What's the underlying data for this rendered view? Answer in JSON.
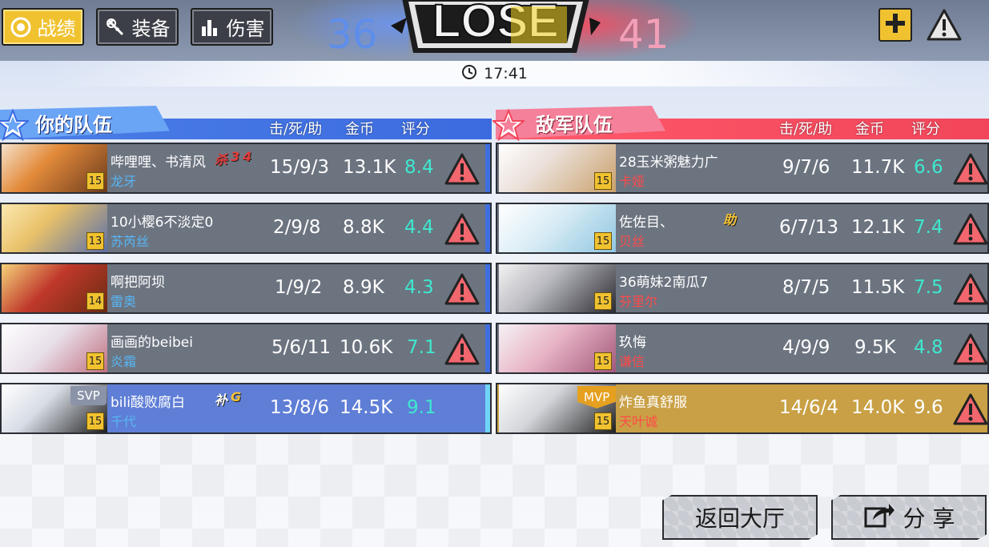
{
  "tabs": [
    {
      "label": "战绩",
      "icon": "target-icon",
      "active": true
    },
    {
      "label": "装备",
      "icon": "equipment-icon",
      "active": false
    },
    {
      "label": "伤害",
      "icon": "bar-chart-icon",
      "active": false
    }
  ],
  "result": {
    "banner": "LOSE",
    "score_ally": "36",
    "score_enemy": "41"
  },
  "timer": {
    "time": "17:41"
  },
  "ally_team": {
    "title": "你的队伍",
    "col_kda": "击/死/助",
    "col_gold": "金币",
    "col_rate": "评分",
    "players": [
      {
        "name": "哔哩哩、书清风",
        "hero": "龙牙",
        "level": "15",
        "kda": "15/9/3",
        "gold": "13.1K",
        "rating": "8.4",
        "tags": [
          "杀",
          "3",
          "4"
        ]
      },
      {
        "name": "10小樱6不淡定0",
        "hero": "苏芮丝",
        "level": "13",
        "kda": "2/9/8",
        "gold": "8.8K",
        "rating": "4.4"
      },
      {
        "name": "啊把阿坝",
        "hero": "雷奥",
        "level": "14",
        "kda": "1/9/2",
        "gold": "8.9K",
        "rating": "4.3"
      },
      {
        "name": "画画的beibei",
        "hero": "炎霜",
        "level": "15",
        "kda": "5/6/11",
        "gold": "10.6K",
        "rating": "7.1"
      },
      {
        "name": "bili酸败腐白",
        "hero": "千代",
        "level": "15",
        "kda": "13/8/6",
        "gold": "14.5K",
        "rating": "9.1",
        "badge": "SVP",
        "tags": [
          "补",
          "G"
        ]
      }
    ]
  },
  "enemy_team": {
    "title": "敌军队伍",
    "col_kda": "击/死/助",
    "col_gold": "金币",
    "col_rate": "评分",
    "players": [
      {
        "name": "28玉米粥魅力广",
        "hero": "卡娅",
        "level": "15",
        "kda": "9/7/6",
        "gold": "11.7K",
        "rating": "6.6"
      },
      {
        "name": "佐佐目、",
        "hero": "贝丝",
        "level": "15",
        "kda": "6/7/13",
        "gold": "12.1K",
        "rating": "7.4",
        "tags": [
          "助"
        ]
      },
      {
        "name": "36萌妹2南瓜7",
        "hero": "芬里尔",
        "level": "15",
        "kda": "8/7/5",
        "gold": "11.5K",
        "rating": "7.5"
      },
      {
        "name": "玖悔",
        "hero": "谦信",
        "level": "15",
        "kda": "4/9/9",
        "gold": "9.5K",
        "rating": "4.8"
      },
      {
        "name": "炸鱼真舒服",
        "hero": "天叶诚",
        "level": "15",
        "kda": "14/6/4",
        "gold": "14.0K",
        "rating": "9.6",
        "badge": "MVP"
      }
    ]
  },
  "buttons": {
    "return_lobby": "返回大厅",
    "share": "分 享"
  },
  "colors": {
    "ally": "#3f6fe0",
    "enemy": "#f2455a",
    "accent": "#f1c230",
    "rating": "#3ee8cf"
  }
}
